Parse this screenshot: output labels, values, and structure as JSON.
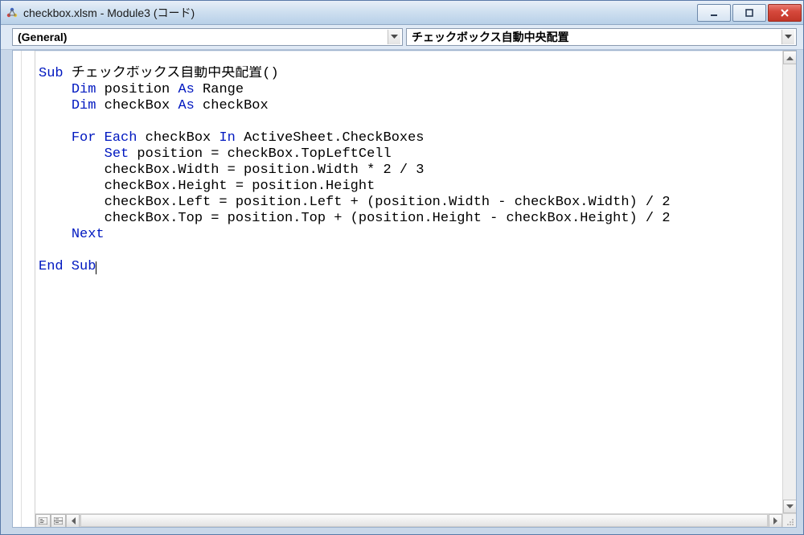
{
  "window": {
    "title": "checkbox.xlsm - Module3 (コード)"
  },
  "dropdowns": {
    "object": "(General)",
    "procedure": "チェックボックス自動中央配置"
  },
  "code": {
    "tokens": [
      [
        [
          "kw",
          "Sub"
        ],
        [
          "",
          " チェックボックス自動中央配置()"
        ]
      ],
      [
        [
          "",
          "    "
        ],
        [
          "kw",
          "Dim"
        ],
        [
          "",
          " position "
        ],
        [
          "kw",
          "As"
        ],
        [
          "",
          " Range"
        ]
      ],
      [
        [
          "",
          "    "
        ],
        [
          "kw",
          "Dim"
        ],
        [
          "",
          " checkBox "
        ],
        [
          "kw",
          "As"
        ],
        [
          "",
          " checkBox"
        ]
      ],
      [
        [
          "",
          ""
        ]
      ],
      [
        [
          "",
          "    "
        ],
        [
          "kw",
          "For Each"
        ],
        [
          "",
          " checkBox "
        ],
        [
          "kw",
          "In"
        ],
        [
          "",
          " ActiveSheet.CheckBoxes"
        ]
      ],
      [
        [
          "",
          "        "
        ],
        [
          "kw",
          "Set"
        ],
        [
          "",
          " position = checkBox.TopLeftCell"
        ]
      ],
      [
        [
          "",
          "        checkBox.Width = position.Width * 2 / 3"
        ]
      ],
      [
        [
          "",
          "        checkBox.Height = position.Height"
        ]
      ],
      [
        [
          "",
          "        checkBox.Left = position.Left + (position.Width - checkBox.Width) / 2"
        ]
      ],
      [
        [
          "",
          "        checkBox.Top = position.Top + (position.Height - checkBox.Height) / 2"
        ]
      ],
      [
        [
          "",
          "    "
        ],
        [
          "kw",
          "Next"
        ]
      ],
      [
        [
          "",
          ""
        ]
      ],
      [
        [
          "kw",
          "End Sub"
        ],
        [
          "cursor",
          ""
        ]
      ]
    ]
  }
}
